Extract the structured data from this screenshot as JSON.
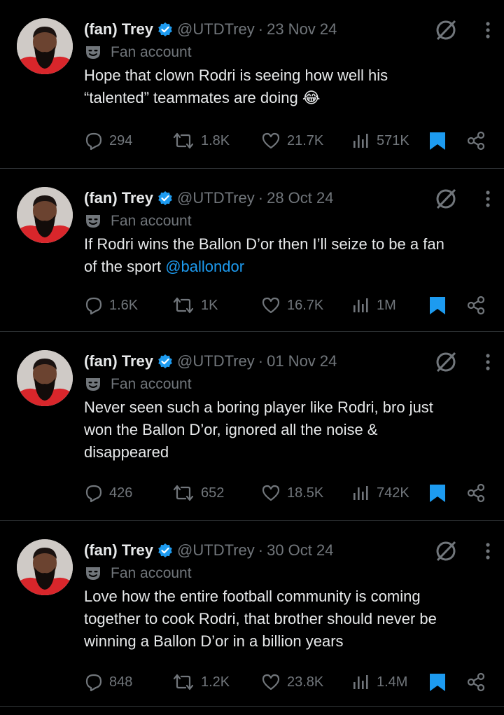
{
  "tweets": [
    {
      "name": "(fan) Trey",
      "handle": "@UTDTrey",
      "dot": "·",
      "date": "23 Nov 24",
      "badge": "Fan account",
      "text_lines": [
        "Hope that clown Rodri is seeing how well his",
        "“talented” teammates are doing 😂"
      ],
      "mention": "",
      "replies": "294",
      "retweets": "1.8K",
      "likes": "21.7K",
      "views": "571K",
      "bookmarked": true
    },
    {
      "name": "(fan) Trey",
      "handle": "@UTDTrey",
      "dot": "·",
      "date": "28 Oct 24",
      "badge": "Fan account",
      "text_lines": [
        "If Rodri wins the Ballon D’or then I’ll seize to be a fan",
        "of the sport "
      ],
      "mention": "@ballondor",
      "replies": "1.6K",
      "retweets": "1K",
      "likes": "16.7K",
      "views": "1M",
      "bookmarked": true
    },
    {
      "name": "(fan) Trey",
      "handle": "@UTDTrey",
      "dot": "·",
      "date": "01 Nov 24",
      "badge": "Fan account",
      "text_lines": [
        "Never seen such a boring player like Rodri, bro just",
        "won the Ballon D’or, ignored all the noise &",
        "disappeared"
      ],
      "mention": "",
      "replies": "426",
      "retweets": "652",
      "likes": "18.5K",
      "views": "742K",
      "bookmarked": true
    },
    {
      "name": "(fan) Trey",
      "handle": "@UTDTrey",
      "dot": "·",
      "date": "30 Oct 24",
      "badge": "Fan account",
      "text_lines": [
        "Love how the entire football community is coming",
        "together to cook Rodri, that brother should never be",
        "winning a Ballon D’or in a billion years"
      ],
      "mention": "",
      "replies": "848",
      "retweets": "1.2K",
      "likes": "23.8K",
      "views": "1.4M",
      "bookmarked": true
    }
  ],
  "colors": {
    "background": "#000000",
    "text": "#e7e9ea",
    "muted": "#71767b",
    "accent": "#1d9bf0",
    "divider": "#2f3336"
  },
  "icons": [
    "verified-badge-icon",
    "mask-icon",
    "no-slash-icon",
    "more-icon",
    "reply-icon",
    "retweet-icon",
    "like-icon",
    "views-icon",
    "bookmark-icon",
    "share-icon"
  ]
}
